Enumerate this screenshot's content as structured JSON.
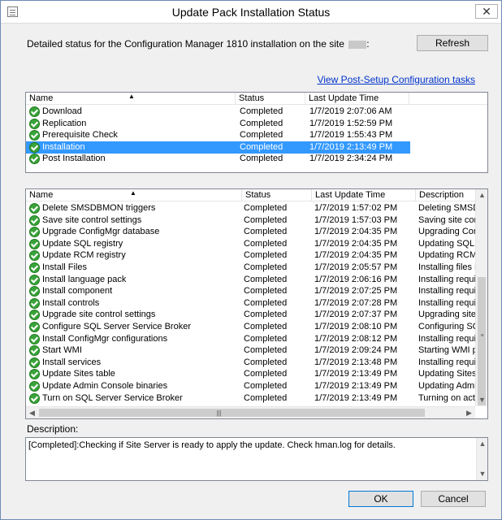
{
  "window": {
    "title": "Update Pack Installation Status",
    "close_glyph": "✕"
  },
  "header": {
    "description": "Detailed status for the Configuration Manager 1810 installation on the site",
    "site_suffix": ":",
    "refresh_button": "Refresh",
    "post_setup_link": "View Post-Setup Configuration tasks"
  },
  "top_list": {
    "columns": [
      "Name",
      "Status",
      "Last Update Time"
    ],
    "rows": [
      {
        "name": "Download",
        "status": "Completed",
        "time": "1/7/2019 2:07:06 AM"
      },
      {
        "name": "Replication",
        "status": "Completed",
        "time": "1/7/2019 1:52:59 PM"
      },
      {
        "name": "Prerequisite Check",
        "status": "Completed",
        "time": "1/7/2019 1:55:43 PM"
      },
      {
        "name": "Installation",
        "status": "Completed",
        "time": "1/7/2019 2:13:49 PM",
        "selected": true
      },
      {
        "name": "Post Installation",
        "status": "Completed",
        "time": "1/7/2019 2:34:24 PM"
      }
    ]
  },
  "bottom_list": {
    "columns": [
      "Name",
      "Status",
      "Last Update Time",
      "Description"
    ],
    "rows": [
      {
        "name": "Delete SMSDBMON triggers",
        "status": "Completed",
        "time": "1/7/2019 1:57:02 PM",
        "desc": "Deleting SMSDBM"
      },
      {
        "name": "Save site control settings",
        "status": "Completed",
        "time": "1/7/2019 1:57:03 PM",
        "desc": "Saving site contro"
      },
      {
        "name": "Upgrade ConfigMgr database",
        "status": "Completed",
        "time": "1/7/2019 2:04:35 PM",
        "desc": "Upgrading ConfigM"
      },
      {
        "name": "Update SQL registry",
        "status": "Completed",
        "time": "1/7/2019 2:04:35 PM",
        "desc": "Updating SQL Se"
      },
      {
        "name": "Update RCM registry",
        "status": "Completed",
        "time": "1/7/2019 2:04:35 PM",
        "desc": "Updating RCM re"
      },
      {
        "name": "Install Files",
        "status": "Completed",
        "time": "1/7/2019 2:05:57 PM",
        "desc": "Installing files req"
      },
      {
        "name": "Install language pack",
        "status": "Completed",
        "time": "1/7/2019 2:06:16 PM",
        "desc": "Installing required"
      },
      {
        "name": "Install component",
        "status": "Completed",
        "time": "1/7/2019 2:07:25 PM",
        "desc": "Installing required"
      },
      {
        "name": "Install controls",
        "status": "Completed",
        "time": "1/7/2019 2:07:28 PM",
        "desc": "Installing required"
      },
      {
        "name": "Upgrade site control settings",
        "status": "Completed",
        "time": "1/7/2019 2:07:37 PM",
        "desc": "Upgrading site co"
      },
      {
        "name": "Configure SQL Server Service Broker",
        "status": "Completed",
        "time": "1/7/2019 2:08:10 PM",
        "desc": "Configuring SQL S"
      },
      {
        "name": "Install ConfigMgr configurations",
        "status": "Completed",
        "time": "1/7/2019 2:08:12 PM",
        "desc": "Installing required"
      },
      {
        "name": "Start WMI",
        "status": "Completed",
        "time": "1/7/2019 2:09:24 PM",
        "desc": "Starting WMI prov"
      },
      {
        "name": "Install services",
        "status": "Completed",
        "time": "1/7/2019 2:13:48 PM",
        "desc": "Installing required"
      },
      {
        "name": "Update Sites table",
        "status": "Completed",
        "time": "1/7/2019 2:13:49 PM",
        "desc": "Updating Sites tab"
      },
      {
        "name": "Update Admin Console binaries",
        "status": "Completed",
        "time": "1/7/2019 2:13:49 PM",
        "desc": "Updating Admin C"
      },
      {
        "name": "Turn on SQL Server Service Broker",
        "status": "Completed",
        "time": "1/7/2019 2:13:49 PM",
        "desc": "Turning on activa"
      }
    ]
  },
  "description_panel": {
    "label": "Description:",
    "text": "[Completed]:Checking if Site Server is ready to apply the update. Check hman.log for details."
  },
  "footer": {
    "ok_button": "OK",
    "cancel_button": "Cancel"
  },
  "icons": {
    "status_icon": "green-check-icon",
    "scroll_up": "▲",
    "scroll_down": "▼",
    "scroll_left": "◀",
    "scroll_right": "▶",
    "sort_up": "▲",
    "grip": "|||"
  },
  "colors": {
    "selection": "#3399ff",
    "link": "#0033cc",
    "check": "#3aa33a"
  }
}
